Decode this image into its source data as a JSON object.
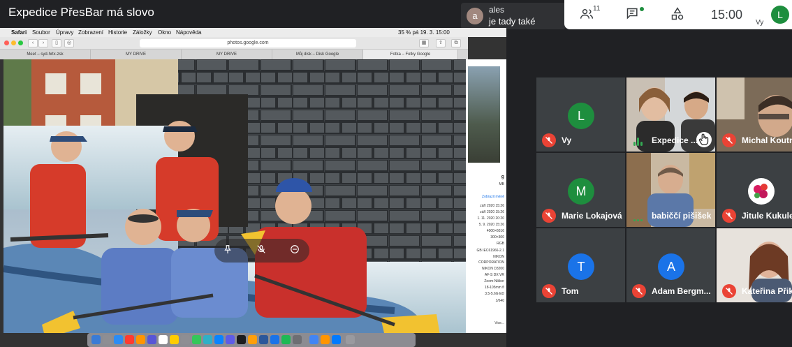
{
  "meeting": {
    "title": "Expedice PřesBar má slovo"
  },
  "chat_popup": {
    "avatar_letter": "a",
    "sender": "ales",
    "message": "je tady také"
  },
  "right_panel": {
    "participants_count": "11",
    "time": "15:00",
    "self_avatar": "L",
    "self_label": "Vy"
  },
  "mac": {
    "menubar": [
      "Safari",
      "Soubor",
      "Úpravy",
      "Zobrazení",
      "Historie",
      "Záložky",
      "Okno",
      "Nápověda"
    ],
    "status": "35 %  pá 19. 3.  15:00",
    "url": "photos.google.com",
    "tabs": [
      "Meet – syd-hrtx-zsk",
      "MY DRIVE",
      "MY DRIVE",
      "Můj disk – Disk Google",
      "Fotka – Fotky Google"
    ],
    "info_lines": [
      "g",
      "MB",
      "Zobrazit méně",
      "září 2020 15:26",
      "září 2020 15:26",
      "1. 11. 2020 20:20",
      "5. 9. 2020 15:26",
      "4000×6016",
      "300×300",
      "RGB",
      "GB IEC61966-2.1",
      "NIKON",
      "CORPORATION",
      "NIKON D3200",
      "AF-S DX VR",
      "Zoom-Nikkor",
      "18-105mm f/",
      "3.5-5.6G ED",
      "1/640",
      "Vice..."
    ]
  },
  "tiles": [
    {
      "name": "Vy",
      "avatar": "L",
      "avatar_color": "#1e8e3e",
      "muted": true
    },
    {
      "name": "Expedice ...",
      "speaking": true
    },
    {
      "name": "Michal Koutn",
      "muted": true
    },
    {
      "name": "Marie Lokajová",
      "avatar": "M",
      "avatar_color": "#1e8e3e",
      "muted": true
    },
    {
      "name": "babiččí pišišek",
      "speaking": true
    },
    {
      "name": "Jitule Kukule",
      "muted": true
    },
    {
      "name": "Tom",
      "avatar": "T",
      "avatar_color": "#1a73e8",
      "muted": true
    },
    {
      "name": "Adam Bergm...",
      "avatar": "A",
      "avatar_color": "#1a73e8",
      "muted": true
    },
    {
      "name": "Kateřina Přik",
      "muted": true
    }
  ]
}
